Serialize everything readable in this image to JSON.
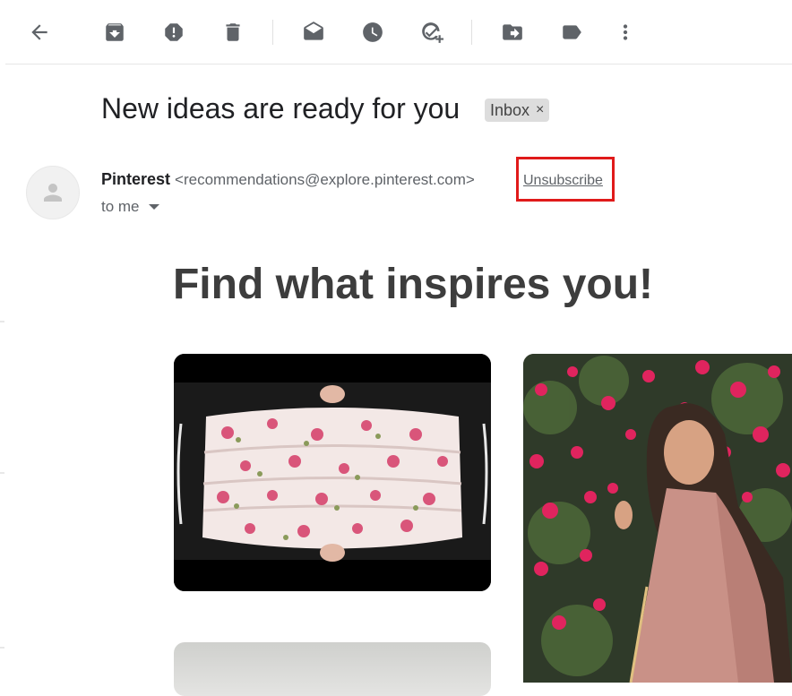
{
  "toolbar": {
    "buttons": [
      {
        "icon": "arrow-back-icon"
      },
      {
        "icon": "archive-icon"
      },
      {
        "icon": "report-spam-icon"
      },
      {
        "icon": "delete-icon"
      },
      {
        "icon": "mark-as-unread-icon"
      },
      {
        "icon": "snooze-icon"
      },
      {
        "icon": "add-to-tasks-icon"
      },
      {
        "icon": "move-to-icon"
      },
      {
        "icon": "label-icon"
      },
      {
        "icon": "more-options-icon"
      }
    ]
  },
  "email": {
    "subject": "New ideas are ready for you",
    "label": "Inbox",
    "label_remove": "×",
    "sender_name": "Pinterest",
    "sender_email": "<recommendations@explore.pinterest.com>",
    "unsubscribe": "Unsubscribe",
    "recipient": "to me"
  },
  "body": {
    "headline": "Find what inspires you!"
  },
  "colors": {
    "highlight": "#e01a1a",
    "icon": "#5f6368",
    "chip": "#dddddd"
  }
}
